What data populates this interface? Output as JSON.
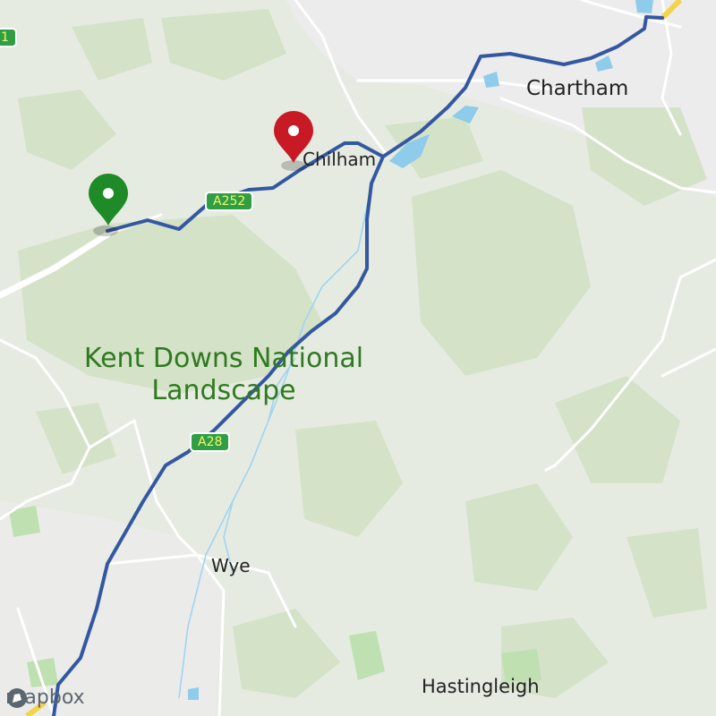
{
  "map": {
    "places": {
      "chartham": "Chartham",
      "chilham": "Chilham",
      "wye": "Wye",
      "hastingleigh": "Hastingleigh"
    },
    "area_label_line1": "Kent Downs National",
    "area_label_line2": "Landscape",
    "roads": {
      "a252": "A252",
      "a28": "A28",
      "edge_badge": "1"
    },
    "markers": {
      "start_color": "#1f8a28",
      "end_color": "#c71a25"
    },
    "route_color": "#3358a2",
    "attribution": "mapbox"
  }
}
